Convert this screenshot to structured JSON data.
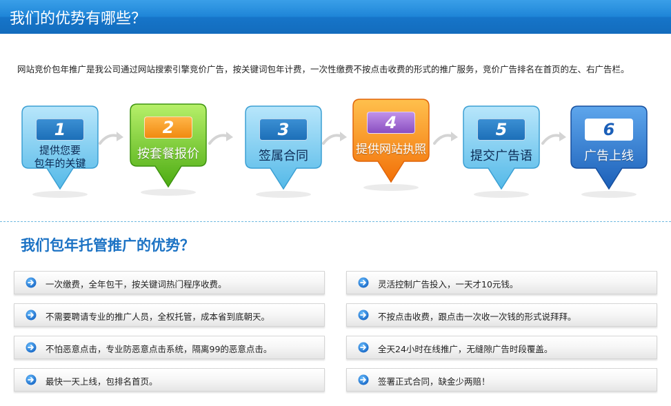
{
  "header": {
    "title": "我们的优势有哪些？"
  },
  "intro": {
    "text": "网站竞价包年推广是我公司通过网站搜索引擎竞价广告，按关键词包年计费，一次性缴费不按点击收费的形式的推广服务，竞价广告排名在首页的左、右广告栏。"
  },
  "steps": [
    {
      "number": "1",
      "line1": "提供您要",
      "line2": "包年的关键",
      "color": "light-blue"
    },
    {
      "number": "2",
      "line1": "按套餐报价",
      "line2": "",
      "color": "green"
    },
    {
      "number": "3",
      "line1": "签属合同",
      "line2": "",
      "color": "light-blue"
    },
    {
      "number": "4",
      "line1": "提供网站执照",
      "line2": "",
      "color": "orange"
    },
    {
      "number": "5",
      "line1": "提交广告语",
      "line2": "",
      "color": "light-blue"
    },
    {
      "number": "6",
      "line1": "广告上线",
      "line2": "",
      "color": "dark-blue"
    }
  ],
  "advantages_title": "我们包年托管推广的优势？",
  "advantages": [
    "一次缴费，全年包干，按关键词热门程序收费。",
    "灵活控制广告投入，一天才10元钱。",
    "不需要聘请专业的推广人员，全权托管，成本省到底朝天。",
    "不按点击收费，跟点击一次收一次钱的形式说拜拜。",
    "不怕恶意点击，专业防恶意点击系统，隔离99的恶意点击。",
    "全天24小时在线推广，无缝隙广告时段覆盖。",
    "最快一天上线，包排名首页。",
    "签署正式合同，缺金少两赔！"
  ],
  "colors": {
    "header": "#1f86d8",
    "accent_blue": "#1b72c4",
    "green": "#5fbf1f",
    "orange": "#f7860f",
    "dark_blue": "#2a6cc6"
  }
}
